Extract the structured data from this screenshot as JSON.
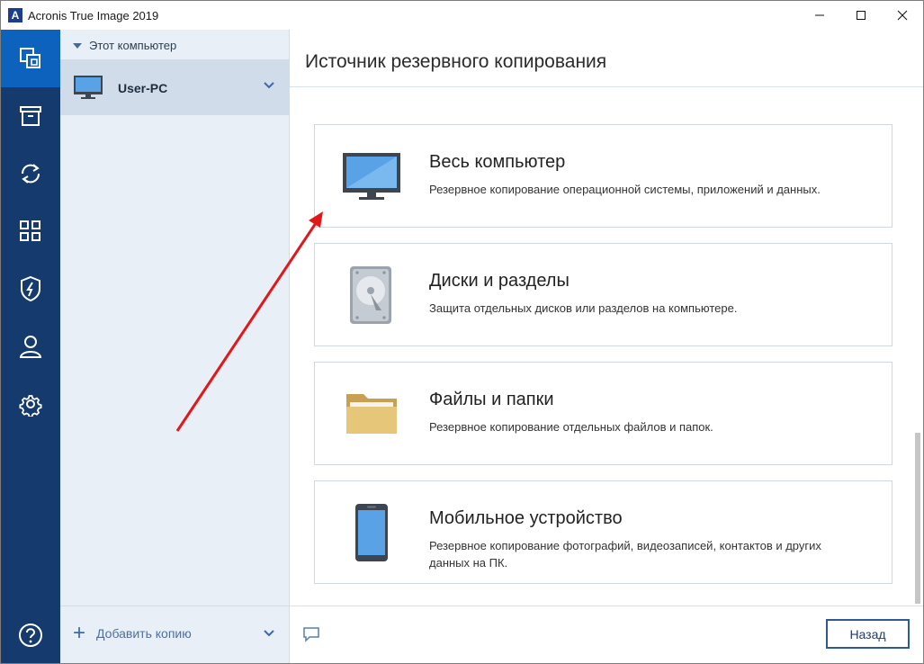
{
  "window": {
    "title": "Acronis True Image 2019",
    "logo_letter": "A",
    "controls": [
      "minimize-icon",
      "maximize-icon",
      "close-icon"
    ]
  },
  "rail": {
    "items": [
      {
        "name": "backup",
        "icon": "copy-icon",
        "active": true
      },
      {
        "name": "archive",
        "icon": "archive-icon"
      },
      {
        "name": "sync",
        "icon": "sync-icon"
      },
      {
        "name": "tools",
        "icon": "grid-icon"
      },
      {
        "name": "protection",
        "icon": "shield-icon"
      },
      {
        "name": "account",
        "icon": "user-icon"
      },
      {
        "name": "settings",
        "icon": "gear-icon"
      }
    ],
    "help_icon": "help-icon"
  },
  "machines": {
    "header": "Этот компьютер",
    "selected": "User-PC",
    "add_copy": "Добавить копию"
  },
  "main": {
    "title": "Источник резервного копирования",
    "cards": [
      {
        "title": "Весь компьютер",
        "description": "Резервное копирование операционной системы, приложений и данных.",
        "icon": "monitor-icon"
      },
      {
        "title": "Диски и разделы",
        "description": "Защита отдельных дисков или разделов на компьютере.",
        "icon": "hard-disk-icon"
      },
      {
        "title": "Файлы и папки",
        "description": "Резервное копирование отдельных файлов и папок.",
        "icon": "folder-icon"
      },
      {
        "title": "Мобильное устройство",
        "description": "Резервное копирование фотографий, видеозаписей, контактов и других данных на ПК.",
        "icon": "phone-icon"
      }
    ],
    "back_button": "Назад",
    "feedback_icon": "chat-icon"
  },
  "colors": {
    "rail": "#143a6e",
    "rail_active": "#0d62bd",
    "panel": "#e9eff6",
    "accent": "#2d5a93",
    "annotation_arrow": "#e0181a"
  }
}
